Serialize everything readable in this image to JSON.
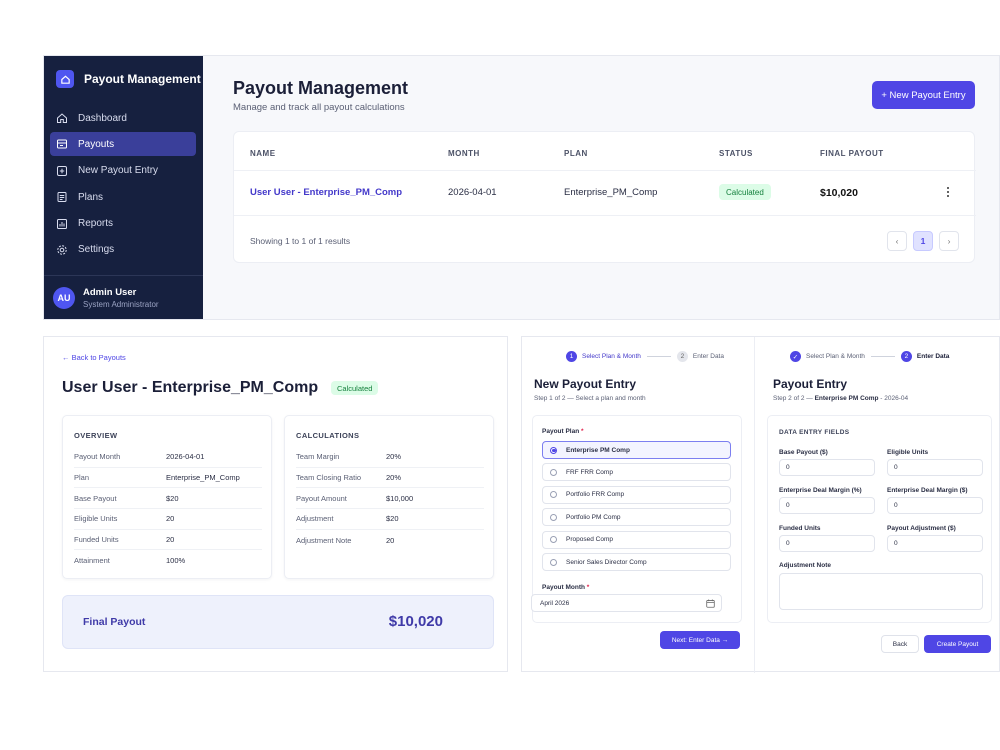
{
  "sidebar": {
    "brand": "Payout Management",
    "items": [
      {
        "label": "Dashboard",
        "icon": "home-icon"
      },
      {
        "label": "Payouts",
        "icon": "payouts-icon"
      },
      {
        "label": "New Payout Entry",
        "icon": "plus-square-icon"
      },
      {
        "label": "Plans",
        "icon": "document-icon"
      },
      {
        "label": "Reports",
        "icon": "report-icon"
      },
      {
        "label": "Settings",
        "icon": "gear-icon"
      }
    ],
    "active_index": 1,
    "user": {
      "initials": "AU",
      "name": "Admin User",
      "role": "System Administrator"
    }
  },
  "list_page": {
    "title": "Payout Management",
    "subtitle": "Manage and track all payout calculations",
    "new_button": "+ New Payout Entry",
    "columns": [
      "NAME",
      "MONTH",
      "PLAN",
      "STATUS",
      "FINAL PAYOUT"
    ],
    "rows": [
      {
        "name": "User User - Enterprise_PM_Comp",
        "month": "2026-04-01",
        "plan": "Enterprise_PM_Comp",
        "status": "Calculated",
        "final_payout": "$10,020"
      }
    ],
    "showing": "Showing 1 to 1 of 1 results",
    "pagination": {
      "prev": "‹",
      "page": "1",
      "next": "›"
    }
  },
  "detail_page": {
    "back_link": "← Back to Payouts",
    "title": "User User - Enterprise_PM_Comp",
    "status": "Calculated",
    "overview": {
      "heading": "OVERVIEW",
      "rows": [
        {
          "key": "Payout Month",
          "value": "2026-04-01"
        },
        {
          "key": "Plan",
          "value": "Enterprise_PM_Comp"
        },
        {
          "key": "Base Payout",
          "value": "$20"
        },
        {
          "key": "Eligible Units",
          "value": "20"
        },
        {
          "key": "Funded Units",
          "value": "20"
        },
        {
          "key": "Attainment",
          "value": "100%"
        }
      ]
    },
    "calculations": {
      "heading": "CALCULATIONS",
      "rows": [
        {
          "key": "Team Margin",
          "value": "20%"
        },
        {
          "key": "Team Closing Ratio",
          "value": "20%"
        },
        {
          "key": "Payout Amount",
          "value": "$10,000"
        },
        {
          "key": "Adjustment",
          "value": "$20"
        },
        {
          "key": "Adjustment Note",
          "value": "20"
        }
      ]
    },
    "final_label": "Final Payout",
    "final_value": "$10,020"
  },
  "new_entry_step1": {
    "steps": [
      {
        "num": "1",
        "label": "Select Plan & Month"
      },
      {
        "num": "2",
        "label": "Enter Data"
      }
    ],
    "title": "New Payout Entry",
    "subtitle": "Step 1 of 2 — Select a plan and month",
    "plan_label": "Payout Plan",
    "required_mark": "*",
    "plans": [
      "Enterprise PM Comp",
      "FRF FRR Comp",
      "Portfolio FRR Comp",
      "Portfolio PM Comp",
      "Proposed Comp",
      "Senior Sales Director Comp"
    ],
    "selected_plan_index": 0,
    "month_label": "Payout Month",
    "month_value": "April 2026",
    "next_button": "Next: Enter Data →"
  },
  "new_entry_step2": {
    "steps": [
      {
        "num": "✓",
        "label": "Select Plan & Month"
      },
      {
        "num": "2",
        "label": "Enter Data"
      }
    ],
    "title": "Payout Entry",
    "subtitle_prefix": "Step 2 of 2 — ",
    "subtitle_plan": "Enterprise PM Comp",
    "subtitle_suffix": " - 2026-04",
    "section_heading": "DATA ENTRY FIELDS",
    "fields": [
      {
        "label": "Base Payout ($)",
        "value": "0"
      },
      {
        "label": "Eligible Units",
        "value": "0"
      },
      {
        "label": "Enterprise Deal Margin (%)",
        "value": "0"
      },
      {
        "label": "Enterprise Deal Margin ($)",
        "value": "0"
      },
      {
        "label": "Funded Units",
        "value": "0"
      },
      {
        "label": "Payout Adjustment ($)",
        "value": "0"
      }
    ],
    "note_label": "Adjustment Note",
    "back_button": "Back",
    "create_button": "Create Payout"
  },
  "colors": {
    "accent": "#4f46e5",
    "sidebar_bg": "#16203f",
    "success_bg": "#dcfce7",
    "success_text": "#15803d"
  }
}
